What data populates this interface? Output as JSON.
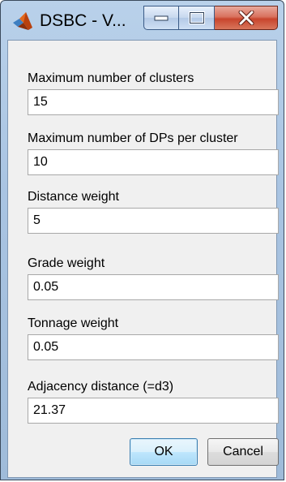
{
  "window": {
    "title": "DSBC - V..."
  },
  "controls": {
    "minimize": "minimize",
    "maximize": "maximize",
    "close": "close"
  },
  "fields": [
    {
      "label": "Maximum number of clusters",
      "value": "15"
    },
    {
      "label": "Maximum number of DPs per cluster",
      "value": "10"
    },
    {
      "label": "Distance weight",
      "value": "5"
    },
    {
      "label": "Grade weight",
      "value": "0.05"
    },
    {
      "label": "Tonnage weight",
      "value": "0.05"
    },
    {
      "label": "Adjacency distance (=d3)",
      "value": "21.37"
    }
  ],
  "buttons": {
    "ok": "OK",
    "cancel": "Cancel"
  },
  "icons": {
    "app": "matlab-logo-icon",
    "minimize": "minimize-icon",
    "maximize": "maximize-icon",
    "close": "close-icon"
  },
  "colors": {
    "titlebar": "#b9d1ea",
    "close_button": "#c8452d",
    "dialog_background": "#f0f0f0",
    "default_button": "#a7d9f5"
  }
}
